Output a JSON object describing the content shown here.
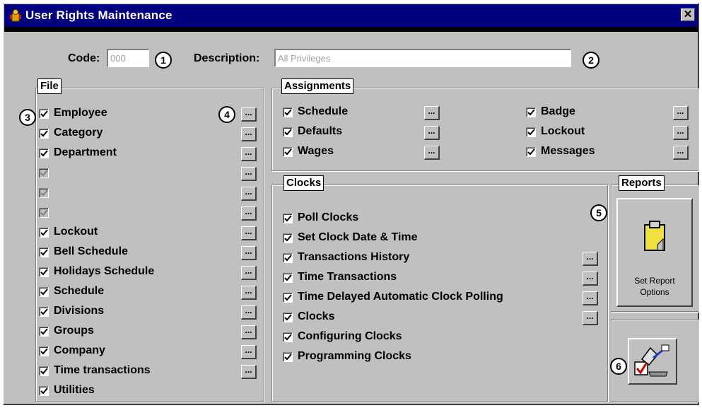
{
  "window": {
    "title": "User Rights Maintenance",
    "close_glyph": "✕"
  },
  "header": {
    "code_label": "Code:",
    "code_value": "000",
    "description_label": "Description:",
    "description_value": "All Privileges",
    "callout_1": "1",
    "callout_2": "2"
  },
  "file": {
    "title": "File",
    "callout_3": "3",
    "callout_4": "4",
    "items": [
      {
        "label": "Employee",
        "checked": true,
        "enabled": true
      },
      {
        "label": "Category",
        "checked": true,
        "enabled": true
      },
      {
        "label": "Department",
        "checked": true,
        "enabled": true
      },
      {
        "label": "",
        "checked": true,
        "enabled": false
      },
      {
        "label": "",
        "checked": true,
        "enabled": false
      },
      {
        "label": "",
        "checked": true,
        "enabled": false
      },
      {
        "label": "Lockout",
        "checked": true,
        "enabled": true
      },
      {
        "label": "Bell Schedule",
        "checked": true,
        "enabled": true
      },
      {
        "label": "Holidays Schedule",
        "checked": true,
        "enabled": true
      },
      {
        "label": "Schedule",
        "checked": true,
        "enabled": true
      },
      {
        "label": "Divisions",
        "checked": true,
        "enabled": true
      },
      {
        "label": "Groups",
        "checked": true,
        "enabled": true
      },
      {
        "label": "Company",
        "checked": true,
        "enabled": true
      },
      {
        "label": "Time transactions",
        "checked": true,
        "enabled": true
      },
      {
        "label": "Utilities",
        "checked": true,
        "enabled": true
      }
    ],
    "dots_label": "..."
  },
  "assignments": {
    "title": "Assignments",
    "items": [
      {
        "label": "Schedule",
        "checked": true
      },
      {
        "label": "Defaults",
        "checked": true
      },
      {
        "label": "Wages",
        "checked": true
      },
      {
        "label": "Badge",
        "checked": true
      },
      {
        "label": "Lockout",
        "checked": true
      },
      {
        "label": "Messages",
        "checked": true
      }
    ]
  },
  "clocks": {
    "title": "Clocks",
    "items": [
      {
        "label": "Poll Clocks",
        "checked": true,
        "has_options": false
      },
      {
        "label": "Set Clock Date & Time",
        "checked": true,
        "has_options": false
      },
      {
        "label": "Transactions History",
        "checked": true,
        "has_options": true
      },
      {
        "label": "Time Transactions",
        "checked": true,
        "has_options": true
      },
      {
        "label": "Time Delayed Automatic Clock Polling",
        "checked": true,
        "has_options": true
      },
      {
        "label": "Clocks",
        "checked": true,
        "has_options": true
      },
      {
        "label": "Configuring Clocks",
        "checked": true,
        "has_options": false
      },
      {
        "label": "Programming Clocks",
        "checked": true,
        "has_options": false
      }
    ]
  },
  "reports": {
    "title": "Reports",
    "callout_5": "5",
    "set_report_line1": "Set Report",
    "set_report_line2": "Options",
    "callout_6": "6"
  },
  "icons": {
    "app": "app-icon",
    "close": "close-icon",
    "clipboard": "clipboard-icon",
    "rights_tool": "rights-tool-icon"
  }
}
